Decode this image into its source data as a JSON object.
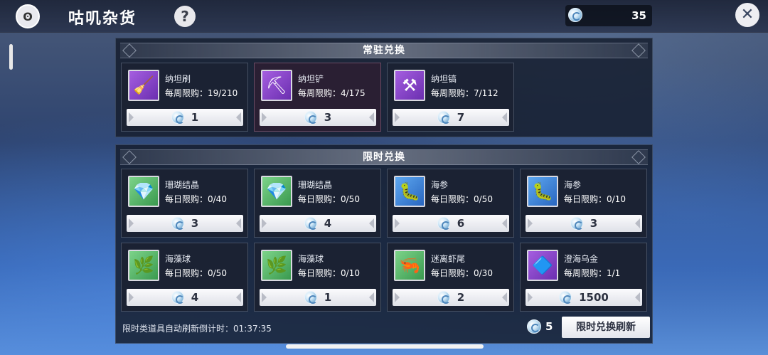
{
  "header": {
    "title": "咕叽杂货",
    "help_label": "?",
    "currency_amount": "35",
    "close_label": "✕"
  },
  "regular": {
    "title": "常驻兑换",
    "items": [
      {
        "name": "纳坦刷",
        "limit": "每周限购：19/210",
        "price": "1",
        "icon": "brush-icon",
        "glyph": "🧹"
      },
      {
        "name": "纳坦铲",
        "limit": "每周限购：4/175",
        "price": "3",
        "icon": "shovel-icon",
        "glyph": "⛏"
      },
      {
        "name": "纳坦镐",
        "limit": "每周限购：7/112",
        "price": "7",
        "icon": "pickaxe-icon",
        "glyph": "⚒"
      }
    ]
  },
  "limited": {
    "title": "限时兑换",
    "items": [
      {
        "name": "珊瑚结晶",
        "limit": "每日限购：0/40",
        "price": "3",
        "icon": "coral-crystal-icon",
        "glyph": "💎"
      },
      {
        "name": "珊瑚结晶",
        "limit": "每日限购：0/50",
        "price": "4",
        "icon": "coral-crystal-icon",
        "glyph": "💎"
      },
      {
        "name": "海参",
        "limit": "每日限购：0/50",
        "price": "6",
        "icon": "sea-cucumber-icon",
        "glyph": "🐛"
      },
      {
        "name": "海参",
        "limit": "每日限购：0/10",
        "price": "3",
        "icon": "sea-cucumber-icon",
        "glyph": "🐛"
      },
      {
        "name": "海藻球",
        "limit": "每日限购：0/50",
        "price": "4",
        "icon": "seaweed-ball-icon",
        "glyph": "🌿"
      },
      {
        "name": "海藻球",
        "limit": "每日限购：0/10",
        "price": "1",
        "icon": "seaweed-ball-icon",
        "glyph": "🌿"
      },
      {
        "name": "迷离虾尾",
        "limit": "每日限购：0/30",
        "price": "2",
        "icon": "shrimp-tail-icon",
        "glyph": "🦐"
      },
      {
        "name": "澄海乌金",
        "limit": "每周限购：1/1",
        "price": "1500",
        "icon": "dark-gold-crystal-icon",
        "glyph": "🔷"
      }
    ],
    "refresh_timer": "限时类道具自动刷新倒计时：01:37:35",
    "refresh_cost": "5",
    "refresh_button": "限时兑换刷新"
  }
}
